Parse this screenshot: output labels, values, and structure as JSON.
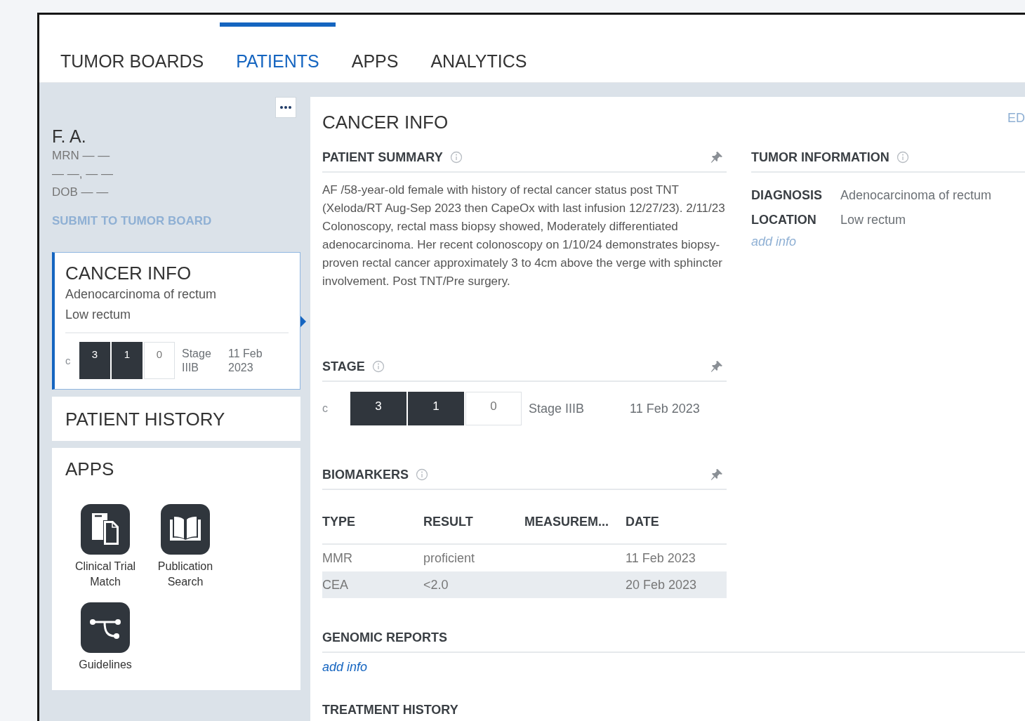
{
  "tabs": [
    {
      "label": "TUMOR BOARDS",
      "selected": false
    },
    {
      "label": "PATIENTS",
      "selected": true
    },
    {
      "label": "APPS",
      "selected": false
    },
    {
      "label": "ANALYTICS",
      "selected": false
    }
  ],
  "patient": {
    "name": "F. A.",
    "details": [
      "MRN — —",
      "— —, — —",
      "DOB — —"
    ],
    "submit": {
      "label": "SUBMIT TO TUMOR BOARD",
      "disabled": true
    }
  },
  "sidebar_cards": [
    {
      "kind": "summary",
      "title": "CANCER INFO",
      "selected": true,
      "lines": [
        "Adenocarcinoma of rectum",
        "Low rectum"
      ],
      "stage": {
        "prefix": "c",
        "boxes": [
          {
            "value": "3",
            "filled": true
          },
          {
            "value": "1",
            "filled": true
          },
          {
            "value": "0",
            "filled": false
          }
        ],
        "stage": "Stage IIIB",
        "date": "11 Feb 2023"
      }
    },
    {
      "kind": "plain",
      "title": "PATIENT HISTORY",
      "selected": false
    },
    {
      "kind": "apps",
      "title": "APPS",
      "selected": false,
      "apps": [
        {
          "kind": "document",
          "label": "Clinical Trial Match"
        },
        {
          "kind": "book",
          "label": "Publication Search"
        },
        {
          "kind": "branch",
          "label": "Guidelines"
        }
      ]
    }
  ],
  "main": {
    "title": "CANCER INFO",
    "edit": "ED",
    "left_sections": [
      {
        "kind": "text",
        "title": "PATIENT SUMMARY",
        "info": true,
        "pin": true,
        "text": "AF /58-year-old female with history of rectal cancer status post TNT (Xeloda/RT Aug-Sep 2023 then CapeOx with last infusion 12/27/23). 2/11/23 Colonoscopy, rectal mass biopsy showed, Moderately differentiated adenocarcinoma. Her recent colonoscopy on 1/10/24 demonstrates biopsy-proven rectal cancer approximately 3 to 4cm above the verge with sphincter involvement. Post TNT/Pre surgery."
      },
      {
        "kind": "stage",
        "title": "STAGE",
        "info": true,
        "pin": true,
        "stage": {
          "prefix": "c",
          "boxes": [
            {
              "value": "3",
              "filled": true
            },
            {
              "value": "1",
              "filled": true
            },
            {
              "value": "0",
              "filled": false
            }
          ],
          "stage": "Stage IIIB",
          "date": "11 Feb 2023"
        }
      },
      {
        "kind": "table",
        "title": "BIOMARKERS",
        "info": true,
        "pin": true,
        "columns": [
          "TYPE",
          "RESULT",
          "MEASUREM...",
          "DATE"
        ],
        "rows": [
          {
            "cells": [
              "MMR",
              "proficient",
              "",
              "11 Feb 2023"
            ],
            "selected": false
          },
          {
            "cells": [
              "CEA",
              "<2.0",
              "",
              "20 Feb 2023"
            ],
            "selected": true
          }
        ]
      }
    ],
    "right_sections": [
      {
        "kind": "fields",
        "title": "TUMOR INFORMATION",
        "info": true,
        "fields": [
          {
            "label": "DIAGNOSIS",
            "value": "Adenocarcinoma of rectum"
          },
          {
            "label": "LOCATION",
            "value": "Low rectum"
          }
        ],
        "add_info": {
          "label": "add info",
          "disabled": true
        }
      }
    ],
    "full_sections": [
      {
        "kind": "fields",
        "title": "GENOMIC REPORTS",
        "add_info": {
          "label": "add info",
          "disabled": false
        }
      },
      {
        "kind": "empty",
        "title": "TREATMENT HISTORY"
      }
    ]
  }
}
